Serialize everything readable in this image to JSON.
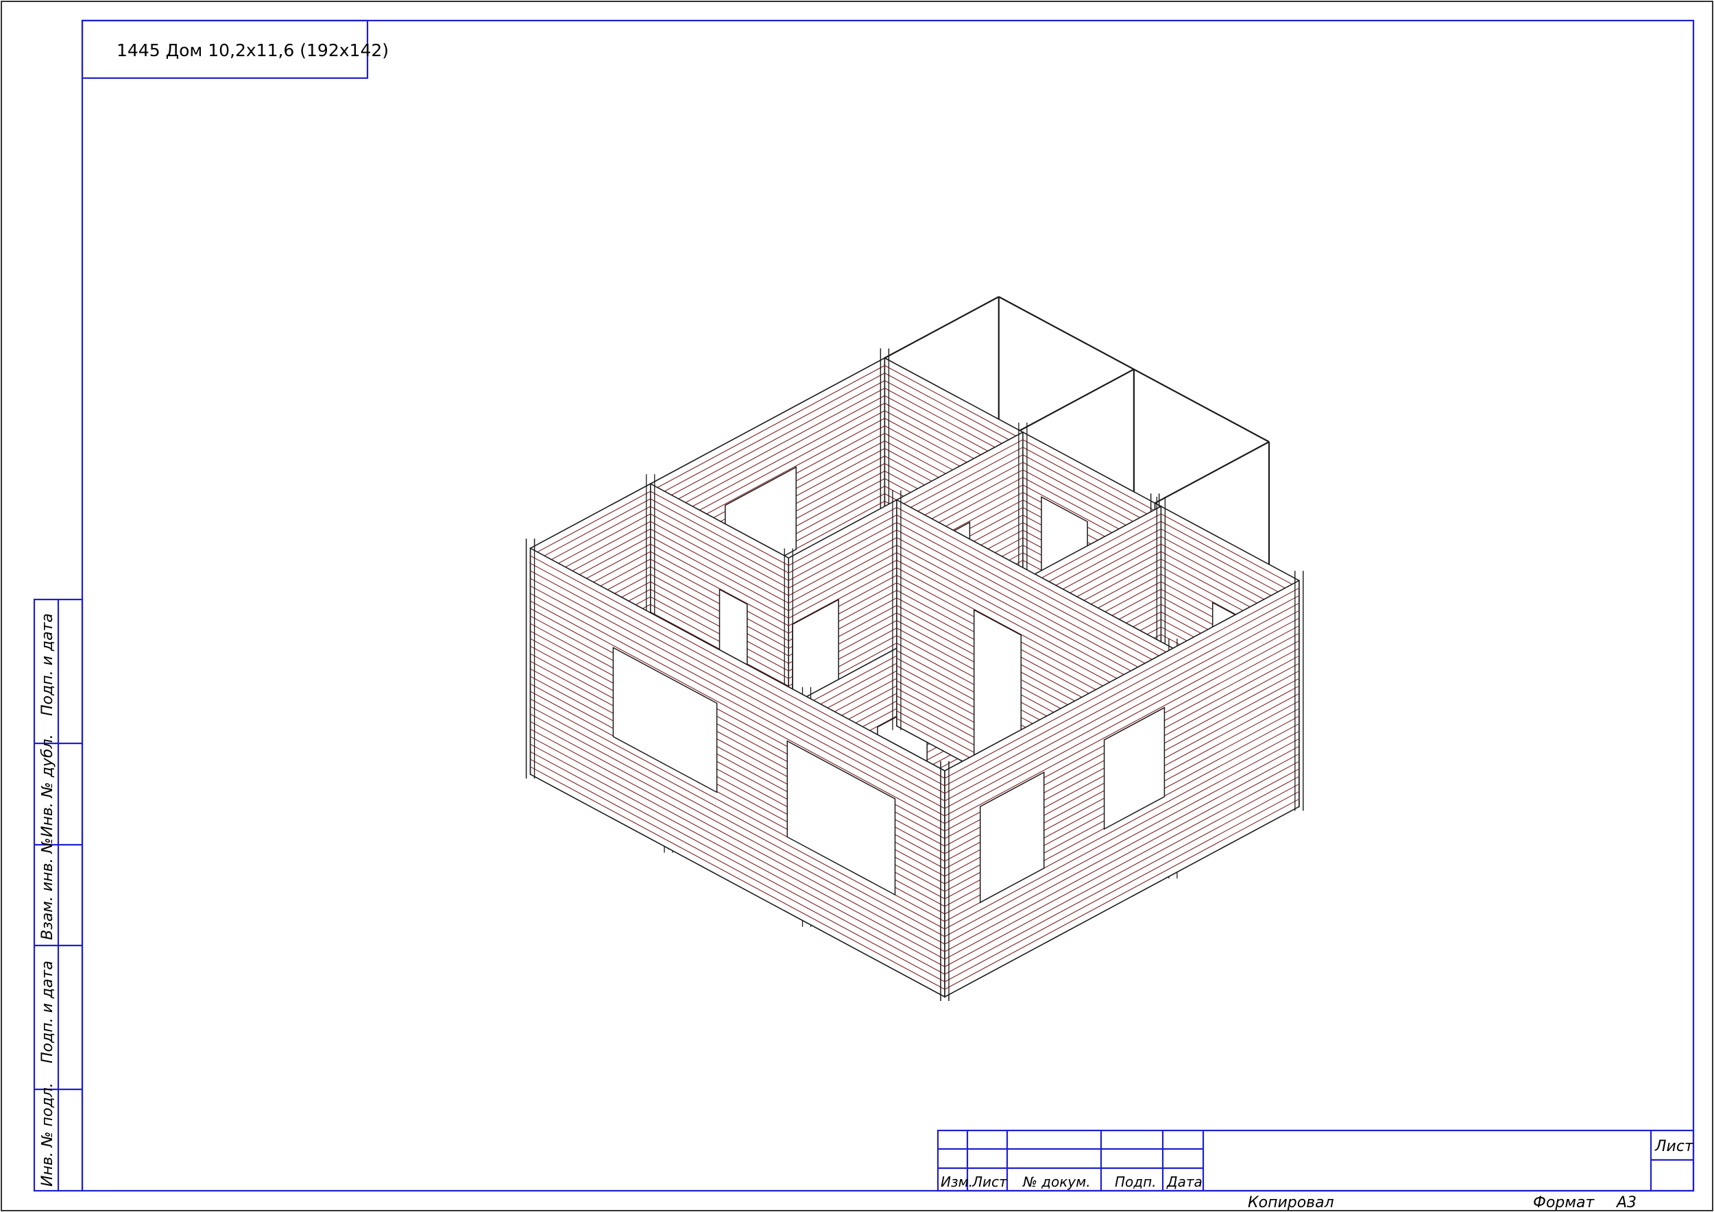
{
  "drawing": {
    "title": "1445 Дом 10,2x11,6 (192x142)"
  },
  "side_stamp": {
    "labels": [
      "Подп. и дата",
      "Инв. № дубл.",
      "Взам. инв. №",
      "Подп. и дата",
      "Инв. № подл."
    ]
  },
  "title_block": {
    "columns": [
      "Изм.",
      "Лист",
      "№ докум.",
      "Подп.",
      "Дата"
    ],
    "sheet_label": "Лист",
    "copied_label": "Копировал",
    "format_label": "Формат",
    "format_value": "A3"
  },
  "colors": {
    "frame": "#1f1fcf",
    "log_lines": "#7a1e1e",
    "outline": "#1a1a1a"
  }
}
